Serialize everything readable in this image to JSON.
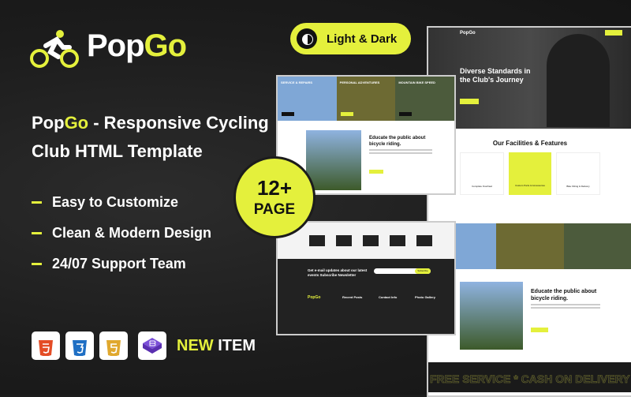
{
  "brand": {
    "pre": "Pop",
    "post": "Go"
  },
  "title": {
    "brand_pre": "Pop",
    "brand_post": "Go",
    "rest": " - Responsive Cycling",
    "line2": "Club HTML Template"
  },
  "features": [
    "Easy to Customize",
    "Clean & Modern Design",
    "24/07 Support Team"
  ],
  "tech_icons": [
    "html5-icon",
    "css3-icon",
    "js-icon",
    "bootstrap-icon"
  ],
  "new_item": {
    "a": "NEW",
    "b": " ITEM"
  },
  "mode_pill": "Light & Dark",
  "pages_badge": {
    "count": "12+",
    "label": "PAGE"
  },
  "mock_right": {
    "logo": "PopGo",
    "hero_title": "Diverse Standards in the Club's Journey",
    "section_title": "Our Facilities & Features",
    "cards": [
      "Complete Overhaul",
      "Custom Parts & Accessories",
      "Bike Fitting & Delivery"
    ],
    "about_title": "Educate the public about bicycle riding.",
    "marquee": "FREE SERVICE  *  CASH ON DELIVERY  *"
  },
  "mock_top": {
    "banners": [
      "SERVICE & REPAIRS",
      "PERSONAL ADVENTURES",
      "MOUNTAIN BIKE SPEED"
    ],
    "about_title": "Educate the public about bicycle riding."
  },
  "mock_bottom": {
    "newsletter": "Get e-mail updates about our latest events Subscribe Newsletter",
    "subscribe": "Subscribe",
    "footer_logo": "PopGo",
    "cols": [
      "Recent Posts",
      "Contact Info",
      "Photo Gallery"
    ]
  },
  "colors": {
    "accent": "#e4f03c",
    "background": "#1c1c1c"
  }
}
